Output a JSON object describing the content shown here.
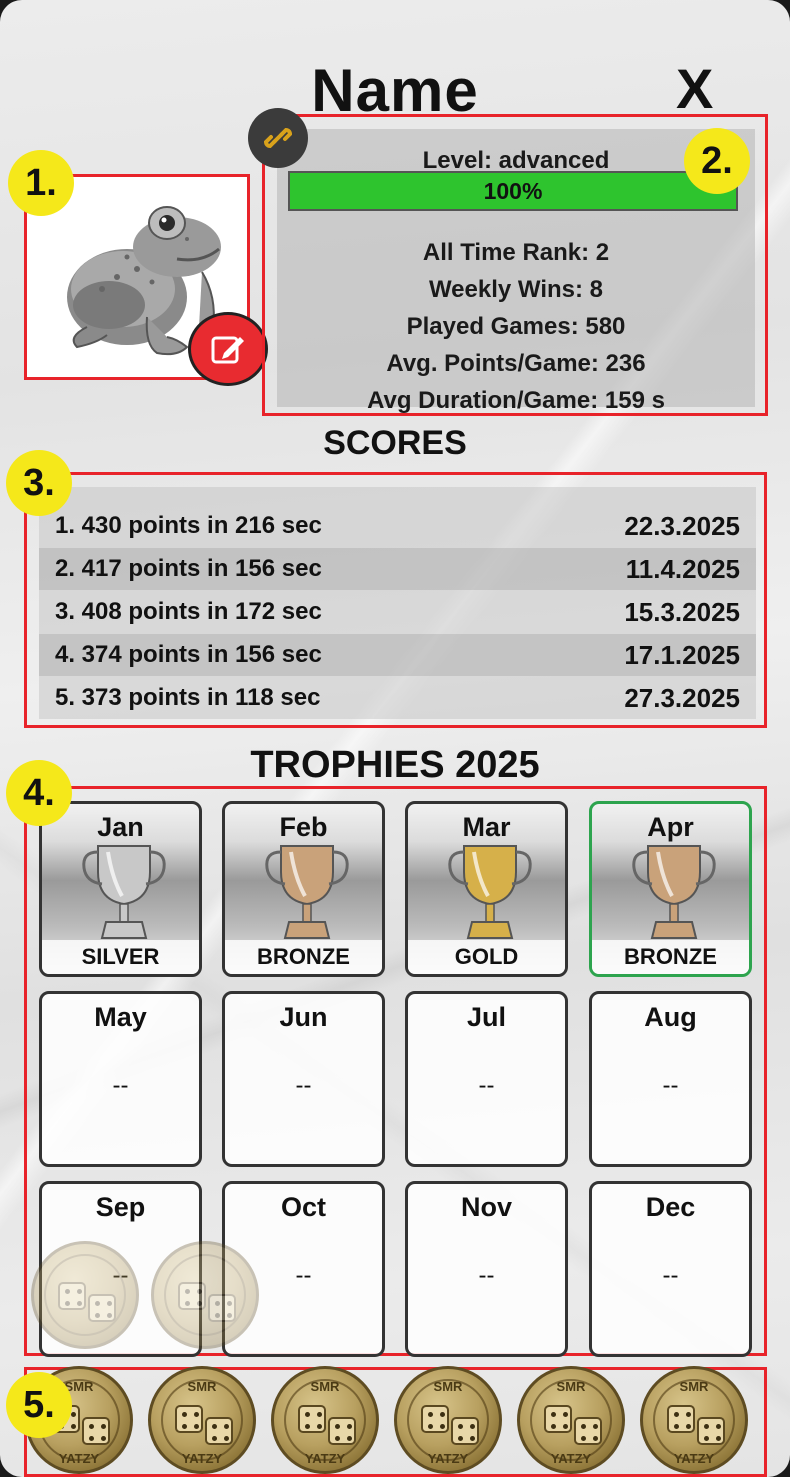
{
  "header": {
    "title": "Name",
    "close_label": "X"
  },
  "badges": [
    "1.",
    "2.",
    "3.",
    "4.",
    "5."
  ],
  "stats": {
    "level": "Level: advanced",
    "progress_pct": 100,
    "progress_label": "100%",
    "rank": "All Time Rank: 2",
    "weekly_wins": "Weekly Wins: 8",
    "played": "Played Games: 580",
    "avg_points": "Avg. Points/Game: 236",
    "avg_duration": "Avg Duration/Game: 159 s"
  },
  "scores": {
    "title": "SCORES",
    "rows": [
      {
        "text": "1. 430 points in 216 sec",
        "date": "22.3.2025"
      },
      {
        "text": "2. 417 points in 156 sec",
        "date": "11.4.2025"
      },
      {
        "text": "3. 408 points in 172 sec",
        "date": "15.3.2025"
      },
      {
        "text": "4. 374 points in 156 sec",
        "date": "17.1.2025"
      },
      {
        "text": "5. 373 points in 118 sec",
        "date": "27.3.2025"
      }
    ]
  },
  "trophies": {
    "title": "TROPHIES 2025",
    "months": [
      {
        "month": "Jan",
        "value": "SILVER",
        "cup_color": "#c8c8c8"
      },
      {
        "month": "Feb",
        "value": "BRONZE",
        "cup_color": "#c9a27a"
      },
      {
        "month": "Mar",
        "value": "GOLD",
        "cup_color": "#d6b04a"
      },
      {
        "month": "Apr",
        "value": "BRONZE",
        "cup_color": "#c9a27a"
      },
      {
        "month": "May",
        "value": "--"
      },
      {
        "month": "Jun",
        "value": "--"
      },
      {
        "month": "Jul",
        "value": "--"
      },
      {
        "month": "Aug",
        "value": "--"
      },
      {
        "month": "Sep",
        "value": "--"
      },
      {
        "month": "Oct",
        "value": "--"
      },
      {
        "month": "Nov",
        "value": "--"
      },
      {
        "month": "Dec",
        "value": "--"
      }
    ]
  },
  "coins": {
    "top_text": "SMR",
    "bottom_text": "YATZY",
    "count": 6
  },
  "colors": {
    "highlight": "#e8232a",
    "badge": "#f5e81a",
    "progress": "#2ec42e",
    "active_tile": "#2da44e",
    "edit": "#e82b30"
  },
  "icons": {
    "avatar": "frog-avatar",
    "edit": "edit-icon",
    "link": "link-icon"
  }
}
